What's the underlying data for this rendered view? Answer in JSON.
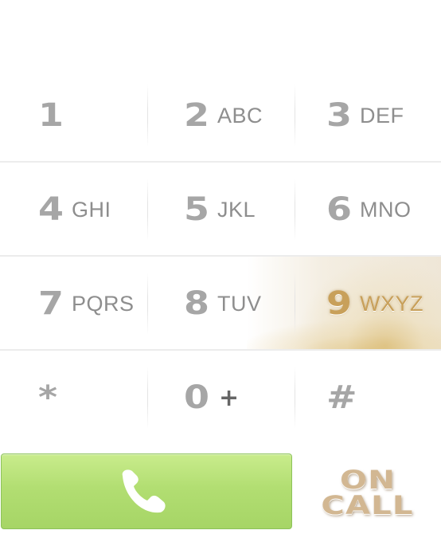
{
  "keypad": {
    "rows": [
      [
        {
          "digit": "1",
          "letters": ""
        },
        {
          "digit": "2",
          "letters": "ABC"
        },
        {
          "digit": "3",
          "letters": "DEF"
        }
      ],
      [
        {
          "digit": "4",
          "letters": "GHI"
        },
        {
          "digit": "5",
          "letters": "JKL"
        },
        {
          "digit": "6",
          "letters": "MNO"
        }
      ],
      [
        {
          "digit": "7",
          "letters": "PQRS"
        },
        {
          "digit": "8",
          "letters": "TUV"
        },
        {
          "digit": "9",
          "letters": "WXYZ"
        }
      ],
      [
        {
          "digit": "*",
          "letters": ""
        },
        {
          "digit": "0",
          "letters": "+"
        },
        {
          "digit": "#",
          "letters": ""
        }
      ]
    ],
    "highlighted_key": "9"
  },
  "call_button": {
    "icon": "phone-icon",
    "color": "#b2de72"
  },
  "on_call": {
    "line1": "ON",
    "line2": "CALL",
    "color": "#d2b792"
  }
}
